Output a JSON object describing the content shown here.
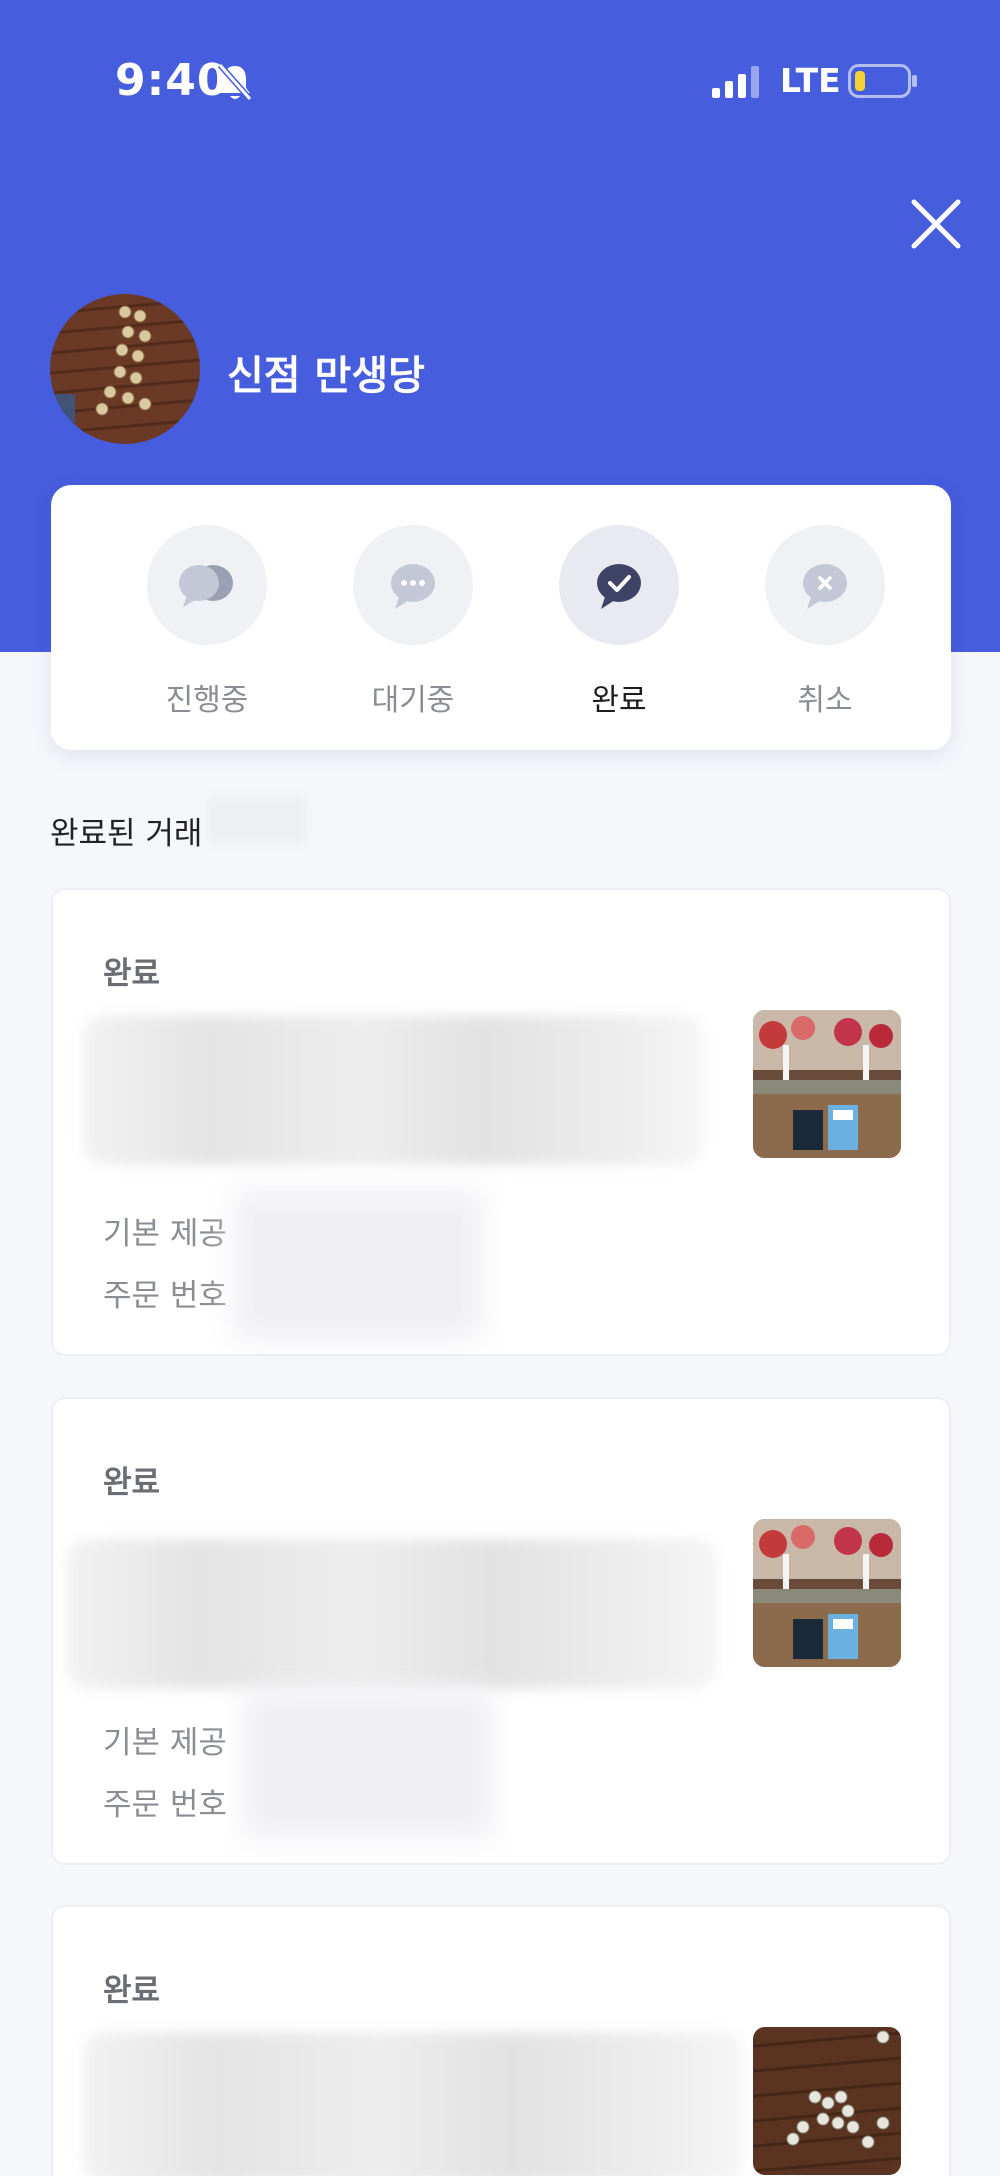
{
  "status_bar": {
    "time": "9:40",
    "network": "LTE"
  },
  "header": {
    "store_name": "신점 만생당",
    "background_color": "#465dde"
  },
  "tabs": [
    {
      "label": "진행중",
      "icon": "chat-bubbles-icon",
      "active": false
    },
    {
      "label": "대기중",
      "icon": "ellipsis-bubble-icon",
      "active": false
    },
    {
      "label": "완료",
      "icon": "check-bubble-icon",
      "active": true
    },
    {
      "label": "취소",
      "icon": "cancel-bubble-icon",
      "active": false
    }
  ],
  "section": {
    "title": "완료된 거래"
  },
  "cards": [
    {
      "status": "완료",
      "row1_label": "기본 제공",
      "row2_label": "주문 번호"
    },
    {
      "status": "완료",
      "row1_label": "기본 제공",
      "row2_label": "주문 번호"
    },
    {
      "status": "완료"
    }
  ]
}
